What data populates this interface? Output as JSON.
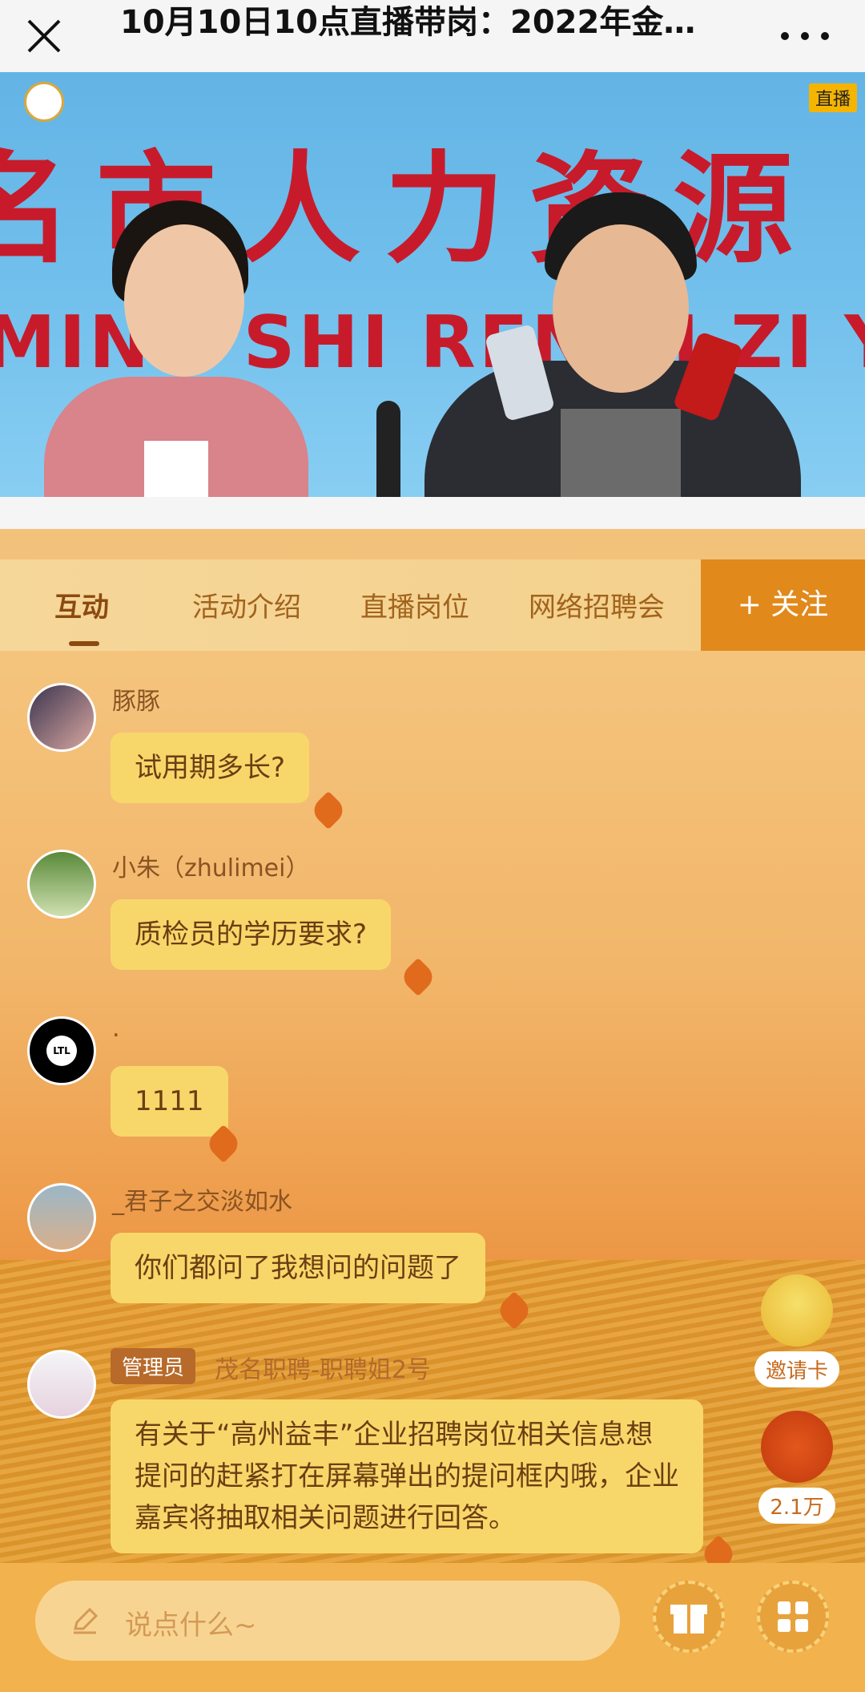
{
  "header": {
    "title": "10月10日10点直播带岗：2022年金…"
  },
  "video": {
    "live_badge": "直播"
  },
  "tabs": [
    {
      "label": "互动"
    },
    {
      "label": "活动介绍"
    },
    {
      "label": "直播岗位"
    },
    {
      "label": "网络招聘会"
    }
  ],
  "follow_label": "+ 关注",
  "messages": [
    {
      "name": "豚豚",
      "text": "试用期多长?"
    },
    {
      "name": "小朱（zhulimei）",
      "text": "质检员的学历要求?"
    },
    {
      "name": ".",
      "text": "1111",
      "avatar_text": "LTL"
    },
    {
      "name": "_君子之交淡如水",
      "text": "你们都问了我想问的问题了"
    },
    {
      "name": "茂名职聘-职聘姐2号",
      "tag": "管理员",
      "text": "有关于“高州益丰”企业招聘岗位相关信息想提问的赶紧打在屏幕弹出的提问框内哦，企业嘉宾将抽取相关问题进行回答。"
    }
  ],
  "side": {
    "invite_label": "邀请卡",
    "likes_count": "2.1万"
  },
  "input": {
    "placeholder": "说点什么~"
  },
  "colors": {
    "accent": "#e1891b",
    "bubble": "#f8d76a"
  }
}
